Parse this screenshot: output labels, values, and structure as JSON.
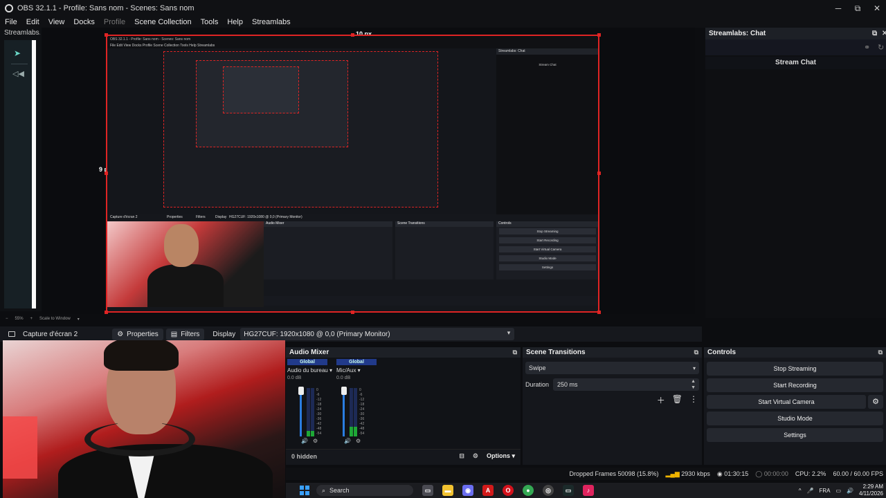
{
  "window": {
    "title": "OBS 32.1.1 - Profile: Sans nom - Scenes: Sans nom",
    "minimize": "─",
    "maximize": "⧉",
    "close": "✕"
  },
  "menu": {
    "items": [
      "File",
      "Edit",
      "View",
      "Docks",
      "Profile",
      "Scene Collection",
      "Tools",
      "Help",
      "Streamlabs"
    ]
  },
  "left_dock": {
    "tab_label": "Streamlabs...",
    "close": "✕"
  },
  "preview": {
    "top_gap": "10 px",
    "left_gap": "9 px",
    "zoom": "55%",
    "scale_label": "Scale to Window",
    "nested": {
      "title": "OBS 32.1.1 - Profile: Sans nom - Scenes: Sans nom",
      "menu": "File  Edit  View  Docks  Profile  Scene Collection  Tools  Help  Streamlabs",
      "chat_title": "Streamlabs: Chat",
      "chat_sub": "Stream Chat",
      "source_name": "Capture d'écran 2",
      "properties": "Properties",
      "filters": "Filters",
      "display_label": "Display",
      "display_value": "HG27CUF: 1920x1080 @ 0,0 (Primary Monitor)",
      "mixer_title": "Audio Mixer",
      "transitions_title": "Scene Transitions",
      "controls_title": "Controls",
      "buttons": [
        "Stop Streaming",
        "Start Recording",
        "Start Virtual Camera",
        "Studio Mode",
        "Settings"
      ]
    }
  },
  "chat_dock": {
    "title": "Streamlabs: Chat",
    "stream_chat": "Stream Chat",
    "popout": "⧉",
    "close": "✕"
  },
  "source_toolbar": {
    "source_name": "Capture d'écran 2",
    "properties": "Properties",
    "filters": "Filters",
    "display_label": "Display",
    "display_value": "HG27CUF: 1920x1080 @ 0,0 (Primary Monitor)"
  },
  "mixer": {
    "title": "Audio Mixer",
    "channels": [
      {
        "global": "Global",
        "name": "Audio du bureau",
        "db": "0.0 dB",
        "level": 0.12
      },
      {
        "global": "Global",
        "name": "Mic/Aux",
        "db": "0.0 dB",
        "level": 0.2
      }
    ],
    "scale": [
      "0",
      "-6",
      "-12",
      "-18",
      "-24",
      "-30",
      "-36",
      "-42",
      "-48",
      "-54",
      "-60"
    ],
    "hidden": "0 hidden",
    "options": "Options"
  },
  "transitions": {
    "title": "Scene Transitions",
    "selected": "Swipe",
    "duration_label": "Duration",
    "duration_value": "250 ms"
  },
  "controls": {
    "title": "Controls",
    "stop_streaming": "Stop Streaming",
    "start_recording": "Start Recording",
    "start_virtual_camera": "Start Virtual Camera",
    "studio_mode": "Studio Mode",
    "settings": "Settings"
  },
  "status": {
    "dropped_frames": "Dropped Frames 50098 (15.8%)",
    "bitrate": "2930 kbps",
    "stream_time": "01:30:15",
    "record_time": "00:00:00",
    "cpu": "CPU: 2.2%",
    "fps": "60.00 / 60.00 FPS"
  },
  "taskbar": {
    "search": "Search",
    "lang": "FRA",
    "time": "2:29 AM",
    "date": "4/11/2026",
    "apps": [
      {
        "icon": "file-explorer-icon",
        "color": "#f2c230",
        "glyph": "▬"
      },
      {
        "icon": "discord-icon",
        "color": "#6a6ef0",
        "glyph": "◉"
      },
      {
        "icon": "amd-icon",
        "color": "#d21a1a",
        "glyph": "A"
      },
      {
        "icon": "opera-icon",
        "color": "#d4121c",
        "glyph": "O"
      },
      {
        "icon": "chrome-icon",
        "color": "#34a853",
        "glyph": "●"
      },
      {
        "icon": "obs-icon",
        "color": "#444",
        "glyph": "◎"
      },
      {
        "icon": "terminal-icon",
        "color": "#1b2a2a",
        "glyph": "▭"
      },
      {
        "icon": "tiktok-icon",
        "color": "#e0245e",
        "glyph": "♪"
      }
    ]
  }
}
